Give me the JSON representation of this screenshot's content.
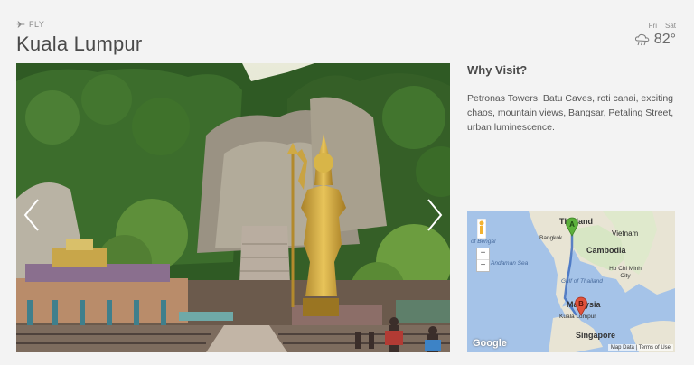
{
  "header": {
    "mode_label": "FLY",
    "city": "Kuala Lumpur"
  },
  "weather": {
    "day1": "Fri",
    "day2": "Sat",
    "temperature": "82°",
    "icon": "rain-cloud-icon"
  },
  "gallery": {
    "prev_icon": "chevron-left-icon",
    "next_icon": "chevron-right-icon"
  },
  "why_visit": {
    "title": "Why Visit?",
    "description": "Petronas Towers, Batu Caves, roti canai, exciting chaos, mountain views, Bangsar, Petaling Street, urban luminescence."
  },
  "map": {
    "labels": {
      "thailand": "Thailand",
      "vietnam": "Vietnam",
      "bangkok": "Bangkok",
      "cambodia": "Cambodia",
      "bay_of_bengal": "of Bengal",
      "andaman_sea": "Andaman Sea",
      "gulf_thailand": "Gulf of Thailand",
      "ho_chi_minh": "Ho Chi Minh City",
      "malaysia": "Malaysia",
      "kuala_lumpur": "Kuala Lumpur",
      "singapore": "Singapore"
    },
    "marker_a": "A",
    "marker_b": "B",
    "zoom_in": "+",
    "zoom_out": "−",
    "logo": "Google",
    "map_data": "Map Data",
    "terms": "Terms of Use"
  }
}
